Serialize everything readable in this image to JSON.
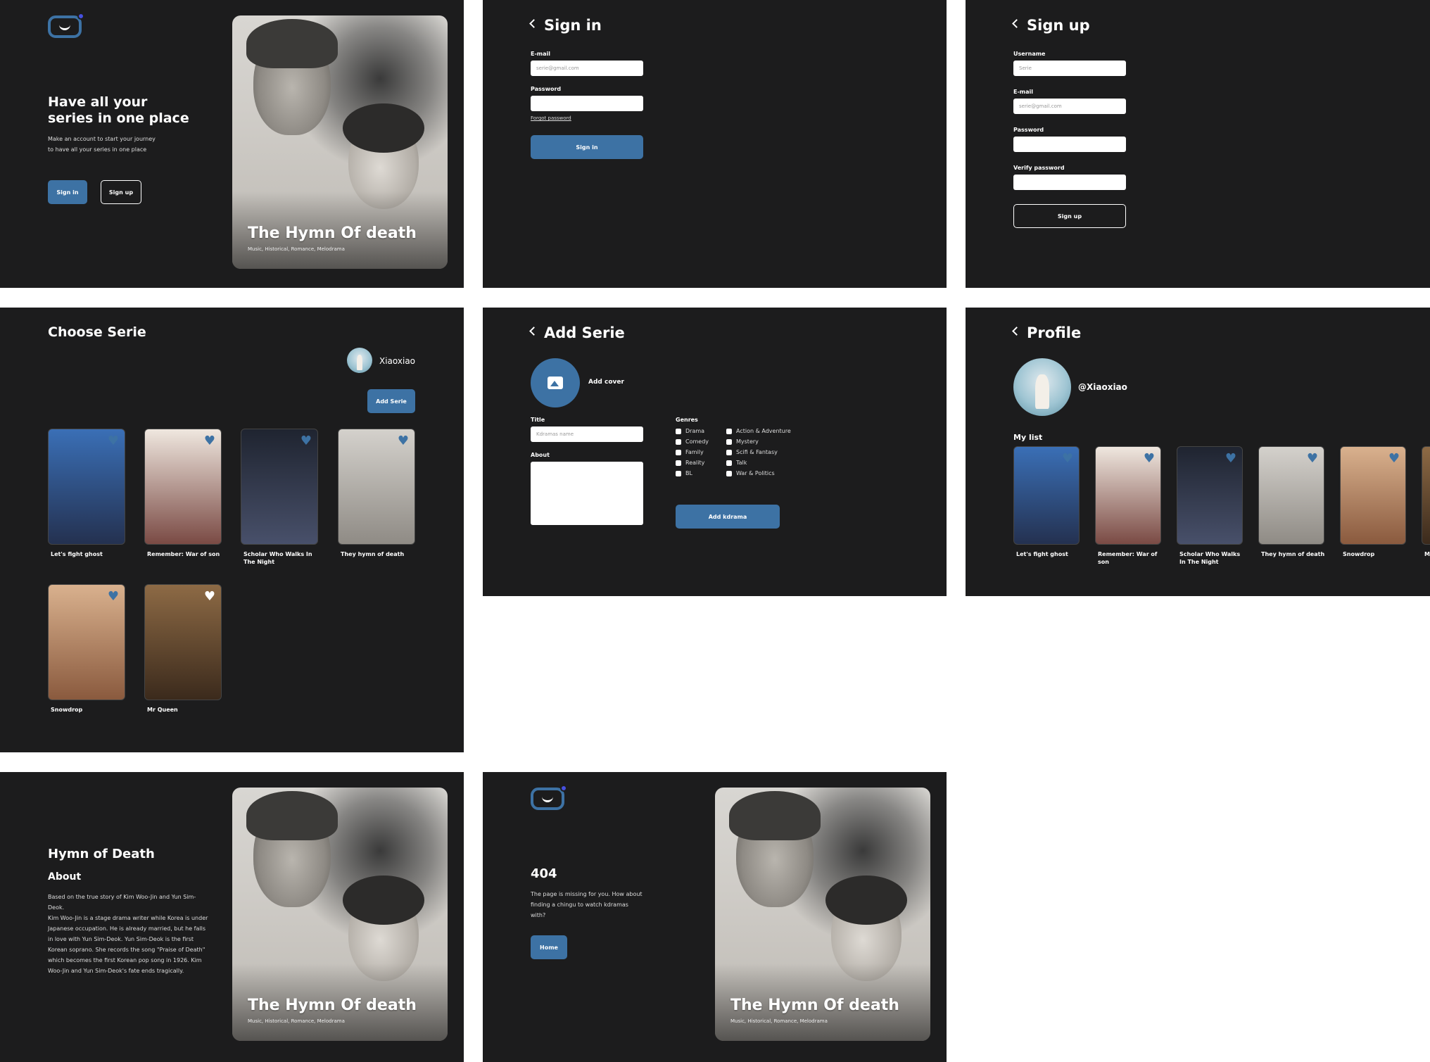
{
  "landing": {
    "headline": "Have all your series in one place",
    "subtext": "Make an account to start your journey to have all your series in one place",
    "signin_label": "Sign in",
    "signup_label": "Sign up"
  },
  "hero": {
    "title": "The Hymn Of death",
    "genres": "Music, Historical, Romance, Melodrama"
  },
  "signin": {
    "title": "Sign in",
    "email_label": "E-mail",
    "email_placeholder": "serie@gmail.com",
    "password_label": "Password",
    "forgot_label": "Forgot password",
    "button_label": "Sign in"
  },
  "signup": {
    "title": "Sign up",
    "username_label": "Username",
    "username_placeholder": "Serie",
    "email_label": "E-mail",
    "email_placeholder": "serie@gmail.com",
    "password_label": "Password",
    "verify_label": "Verify password",
    "button_label": "Sign up"
  },
  "choose": {
    "title": "Choose Serie",
    "user_name": "Xiaoxiao",
    "add_label": "Add Serie",
    "series": [
      {
        "title": "Let's fight ghost",
        "color": "#2f4f83"
      },
      {
        "title": "Remember: War of son",
        "color": "#6e5b55"
      },
      {
        "title": "Scholar Who Walks In The Night",
        "color": "#2d3142"
      },
      {
        "title": "They hymn of death",
        "color": "#a7a49f"
      },
      {
        "title": "Snowdrop",
        "color": "#b98463"
      },
      {
        "title": "Mr Queen",
        "color": "#6b4a2f"
      }
    ]
  },
  "add": {
    "title": "Add Serie",
    "add_cover": "Add cover",
    "title_label": "Title",
    "title_placeholder": "Kdramas name",
    "about_label": "About",
    "genres_label": "Genres",
    "genres_col1": [
      "Drama",
      "Comedy",
      "Family",
      "Reality",
      "BL"
    ],
    "genres_col2": [
      "Action & Adventure",
      "Mystery",
      "Scifi & Fantasy",
      "Talk",
      "War & Politics"
    ],
    "button_label": "Add kdrama"
  },
  "profile": {
    "title": "Profile",
    "handle": "@Xiaoxiao",
    "list_label": "My list",
    "list": [
      {
        "title": "Let's fight ghost",
        "color": "#2f4f83"
      },
      {
        "title": "Remember: War of son",
        "color": "#6e5b55"
      },
      {
        "title": "Scholar Who Walks In The Night",
        "color": "#2d3142"
      },
      {
        "title": "They hymn of death",
        "color": "#a7a49f"
      },
      {
        "title": "Snowdrop",
        "color": "#b98463"
      }
    ],
    "overflow_label": "M"
  },
  "detail": {
    "title": "Hymn of Death",
    "about_label": "About",
    "about_text": "Based on the true story of Kim Woo-Jin and Yun Sim-Deok.\nKim Woo-Jin is a stage drama writer while Korea is under Japanese occupation. He is already married, but he falls in love with Yun Sim-Deok. Yun Sim-Deok is the first Korean soprano. She records the song \"Praise of Death\" which becomes the first Korean pop song in 1926. Kim Woo-Jin and Yun Sim-Deok's fate ends tragically."
  },
  "notfound": {
    "code": "404",
    "message": "The page is missing for you. How about finding a chingu to watch kdramas with?",
    "button_label": "Home"
  },
  "colors": {
    "background": "#1c1c1d",
    "accent": "#3d72a4",
    "logo_dot": "#4650e0"
  }
}
